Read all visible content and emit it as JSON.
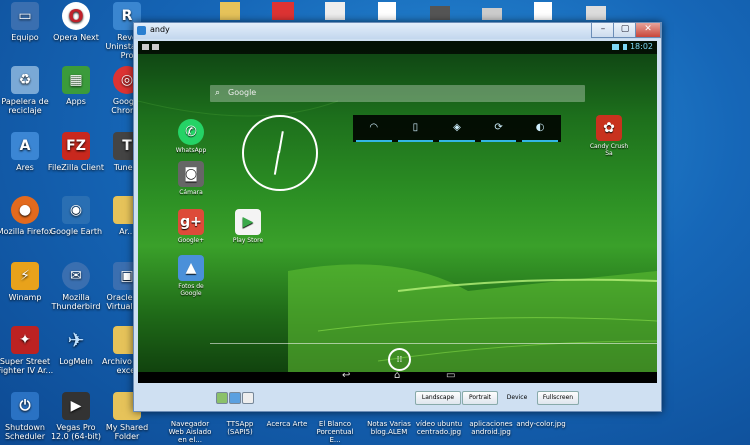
{
  "desktop": {
    "left_icons": [
      {
        "label": "Equipo",
        "icon": "computer-icon",
        "color": "#3a6fb0"
      },
      {
        "label": "Papelera de reciclaje",
        "icon": "recycle-bin-icon",
        "color": "#7aa9d6"
      },
      {
        "label": "Ares",
        "icon": "ares-icon",
        "color": "#3b86d4"
      },
      {
        "label": "Mozilla Firefox",
        "icon": "firefox-icon",
        "color": "#e36a1e"
      },
      {
        "label": "Winamp",
        "icon": "winamp-icon",
        "color": "#e8a21b"
      },
      {
        "label": "Super Street Fighter IV Ar...",
        "icon": "game-icon",
        "color": "#b22"
      },
      {
        "label": "Shutdown Scheduler",
        "icon": "shutdown-icon",
        "color": "#2a72c3"
      }
    ],
    "second_col_icons": [
      {
        "label": "Opera Next",
        "icon": "opera-icon",
        "color": "#c0202a"
      },
      {
        "label": "Apps",
        "icon": "apps-icon",
        "color": "#3b9b3b"
      },
      {
        "label": "FileZilla Client",
        "icon": "filezilla-icon",
        "color": "#c8281e"
      },
      {
        "label": "Google Earth",
        "icon": "google-earth-icon",
        "color": "#2a6fb3"
      },
      {
        "label": "Mozilla Thunderbird",
        "icon": "thunderbird-icon",
        "color": "#3a6fb0"
      },
      {
        "label": "LogMeIn",
        "icon": "bird-icon",
        "color": "#1f66b8"
      },
      {
        "label": "Vegas Pro 12.0 (64-bit)",
        "icon": "vegas-icon",
        "color": "#333"
      }
    ],
    "third_col_icons": [
      {
        "label": "Revo Uninstaller Pro",
        "icon": "revo-icon",
        "color": "#3a86d0"
      },
      {
        "label": "Google Chrome",
        "icon": "chrome-icon",
        "color": "#d33"
      },
      {
        "label": "Tune...",
        "icon": "tuneup-icon",
        "color": "#444"
      },
      {
        "label": "Ar...",
        "icon": "folder-icon",
        "color": "#e6c35a"
      },
      {
        "label": "Oracle VM VirtualBox",
        "icon": "virtualbox-icon",
        "color": "#3b6fb0"
      },
      {
        "label": "Archivo de... excel",
        "icon": "folder-icon",
        "color": "#e6c35a"
      },
      {
        "label": "My Shared Folder",
        "icon": "folder-icon",
        "color": "#e6c35a"
      }
    ],
    "top_row_labels": [
      "Equipo",
      "Opera Next",
      "Revo Un... Pro"
    ],
    "bottom_labels": [
      "Navegador Web Aislado en el...",
      "TTSApp (SAPI5)",
      "Acerca Arte",
      "El Blanco Porcentual E...",
      "Notas Varias blog.ALEM",
      "vídeo ubuntu centrado.jpg",
      "aplicaciones android.jpg",
      "andy-color.jpg"
    ]
  },
  "window": {
    "title": "andy",
    "controls": [
      "–",
      "▢",
      "✕"
    ]
  },
  "android": {
    "clock": "18:02",
    "search_placeholder": "Google",
    "quick_settings": [
      "wifi-icon",
      "vibrate-icon",
      "location-icon",
      "sync-icon",
      "brightness-icon"
    ],
    "apps": [
      {
        "label": "WhatsApp",
        "icon": "whatsapp-icon",
        "color": "#25d366"
      },
      {
        "label": "Cámara",
        "icon": "camera-icon",
        "color": "#555"
      },
      {
        "label": "Google+",
        "icon": "google-plus-icon",
        "color": "#dd4b39"
      },
      {
        "label": "Fotos de Google",
        "icon": "photos-icon",
        "color": "#4a90d9"
      },
      {
        "label": "Play Store",
        "icon": "play-store-icon",
        "color": "#f4f4f4"
      },
      {
        "label": "Candy Crush Sa",
        "icon": "candy-crush-icon",
        "color": "#c8321e"
      }
    ],
    "nav": [
      "back-icon",
      "home-icon",
      "recents-icon"
    ]
  },
  "toolbar": {
    "buttons": [
      "Landscape",
      "Portrait",
      "Device",
      "Fullscreen"
    ]
  }
}
